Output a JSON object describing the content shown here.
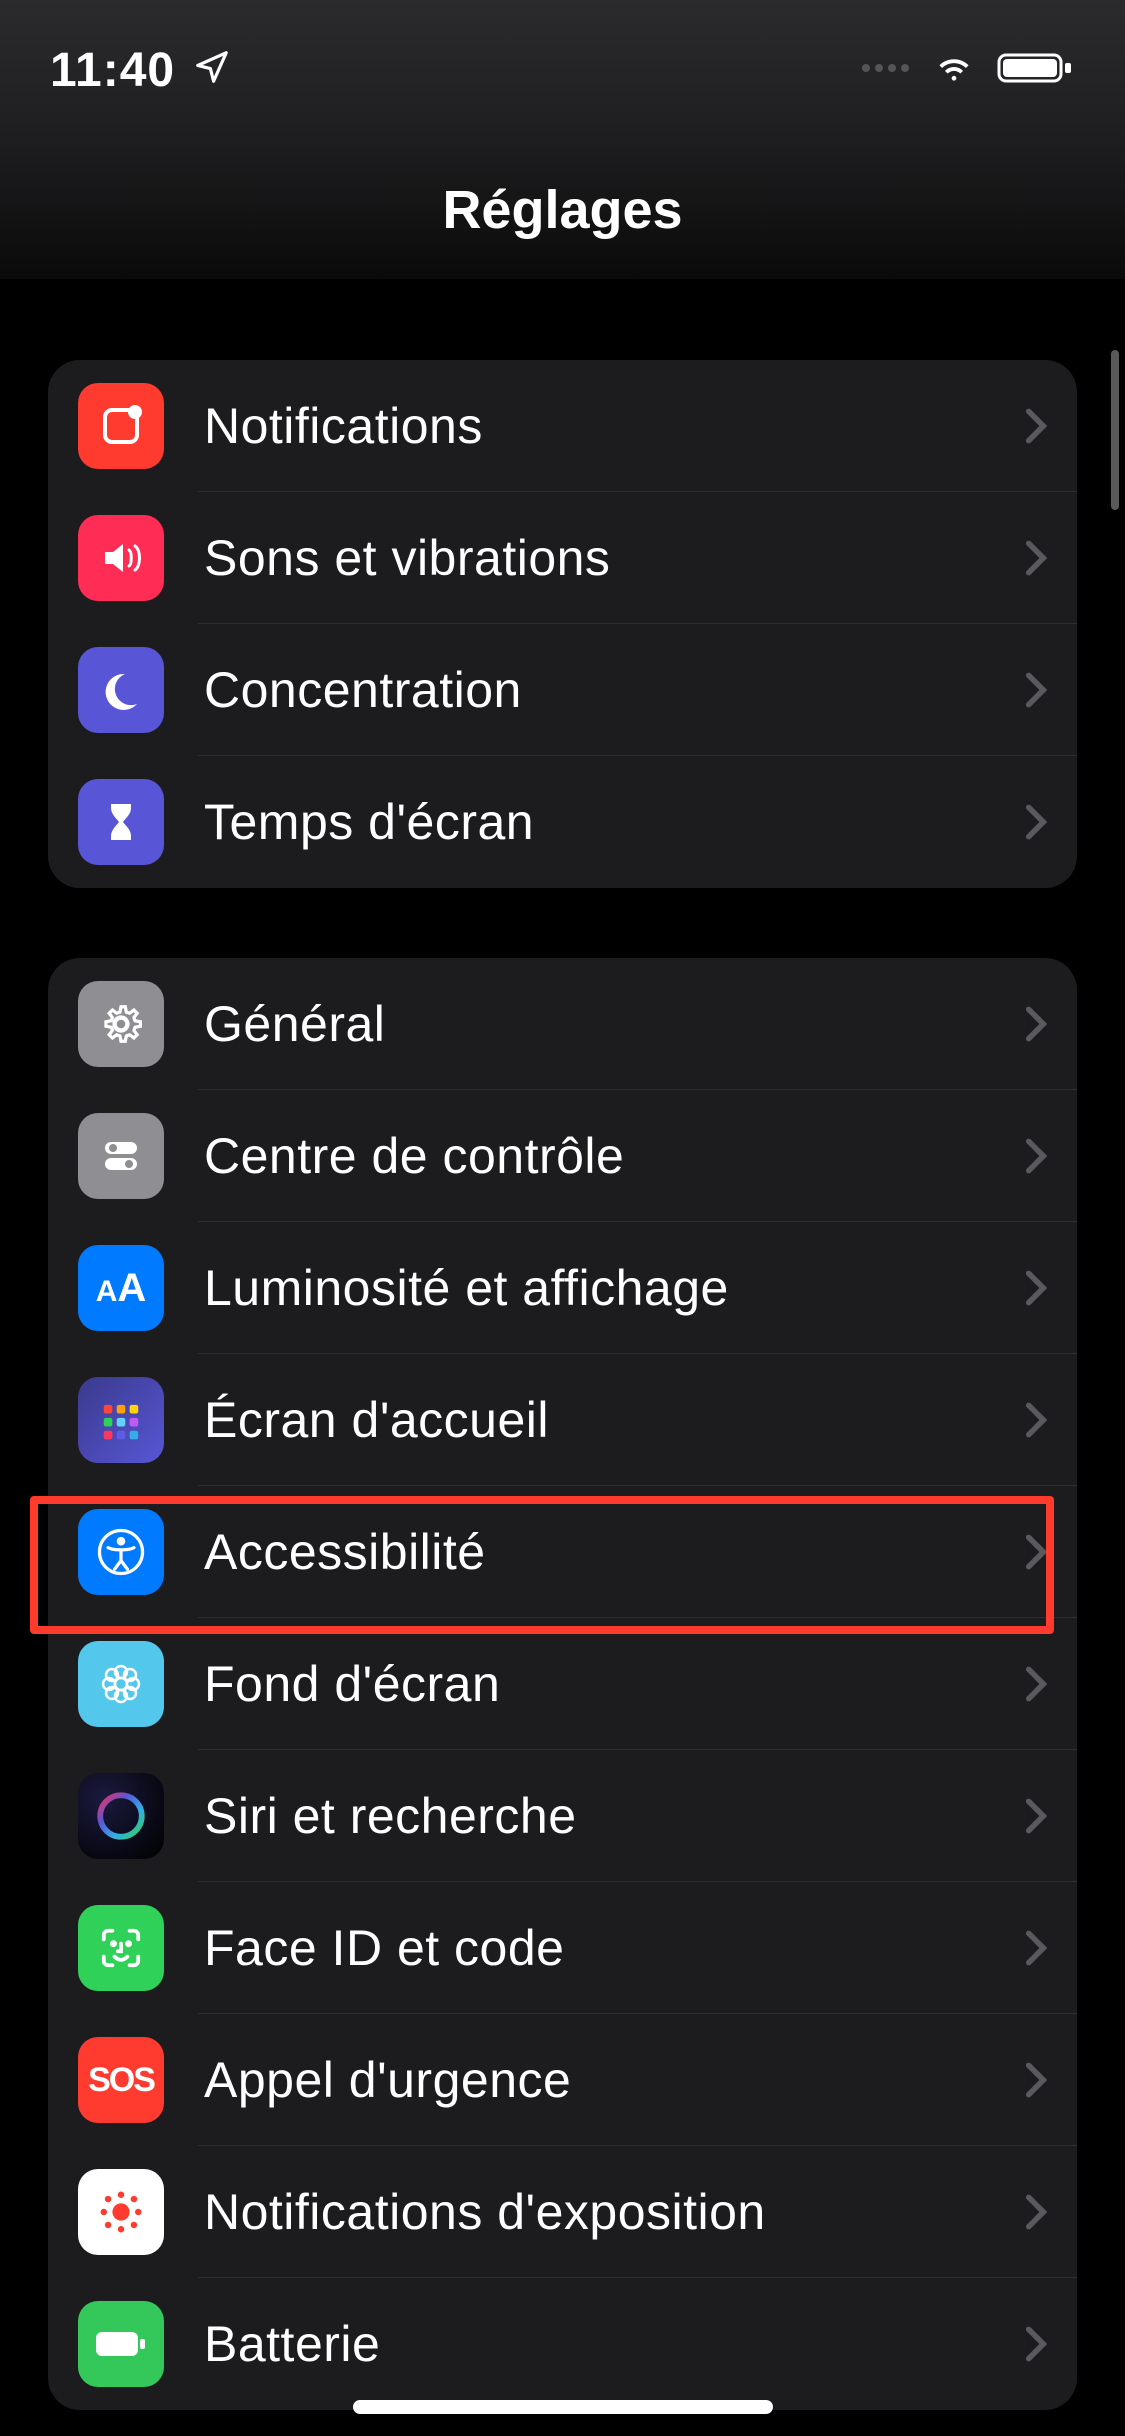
{
  "status": {
    "time": "11:40"
  },
  "header": {
    "title": "Réglages"
  },
  "groups": [
    {
      "id": "group-1",
      "items": [
        {
          "id": "notifications",
          "label": "Notifications",
          "icon": "notifications",
          "bg": "bg-red"
        },
        {
          "id": "sounds",
          "label": "Sons et vibrations",
          "icon": "sounds",
          "bg": "bg-pink"
        },
        {
          "id": "focus",
          "label": "Concentration",
          "icon": "focus",
          "bg": "bg-indigo"
        },
        {
          "id": "screentime",
          "label": "Temps d'écran",
          "icon": "screentime",
          "bg": "bg-indigo"
        }
      ]
    },
    {
      "id": "group-2",
      "items": [
        {
          "id": "general",
          "label": "Général",
          "icon": "general",
          "bg": "bg-gray"
        },
        {
          "id": "control-center",
          "label": "Centre de contrôle",
          "icon": "control-center",
          "bg": "bg-gray"
        },
        {
          "id": "display",
          "label": "Luminosité et affichage",
          "icon": "display",
          "bg": "bg-blue"
        },
        {
          "id": "home-screen",
          "label": "Écran d'accueil",
          "icon": "home-screen",
          "bg": "bg-blue"
        },
        {
          "id": "accessibility",
          "label": "Accessibilité",
          "icon": "accessibility",
          "bg": "bg-blue",
          "highlighted": true
        },
        {
          "id": "wallpaper",
          "label": "Fond d'écran",
          "icon": "wallpaper",
          "bg": "bg-cyan"
        },
        {
          "id": "siri",
          "label": "Siri et recherche",
          "icon": "siri",
          "bg": "bg-black"
        },
        {
          "id": "faceid",
          "label": "Face ID et code",
          "icon": "faceid",
          "bg": "bg-green"
        },
        {
          "id": "emergency",
          "label": "Appel d'urgence",
          "icon": "emergency",
          "bg": "bg-red"
        },
        {
          "id": "exposure",
          "label": "Notifications d'exposition",
          "icon": "exposure",
          "bg": "bg-white"
        },
        {
          "id": "battery",
          "label": "Batterie",
          "icon": "battery",
          "bg": "bg-green2"
        }
      ]
    }
  ]
}
